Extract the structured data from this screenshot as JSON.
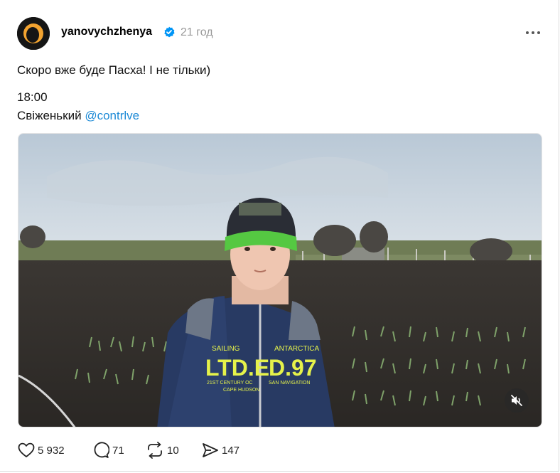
{
  "post": {
    "username": "yanovychzhenya",
    "time": "21 год",
    "line1": "Скоро вже буде Пасха! І не тільки)",
    "line2": "18:00",
    "line3_prefix": "Свіженький ",
    "mention": "@contrlve"
  },
  "media": {
    "jacket_text_1": "LTD.E",
    "jacket_text_2": "D.97",
    "jacket_small_1": "SAILING",
    "jacket_small_2": "ANTARCTICA",
    "jacket_small_3": "21ST CENTURY OC",
    "jacket_small_4": "CAPE HUDSON",
    "jacket_small_5": "SAN NAVIGATION"
  },
  "actions": {
    "likes": "5 932",
    "comments": "71",
    "reposts": "10",
    "shares": "147"
  },
  "icons": [
    "avatar",
    "verified-icon",
    "more-icon",
    "mute-icon",
    "heart-icon",
    "comment-icon",
    "repost-icon",
    "share-icon"
  ],
  "colors": {
    "accent": "#1d8ad6",
    "verified": "#0095f6",
    "muted_text": "#999999"
  }
}
